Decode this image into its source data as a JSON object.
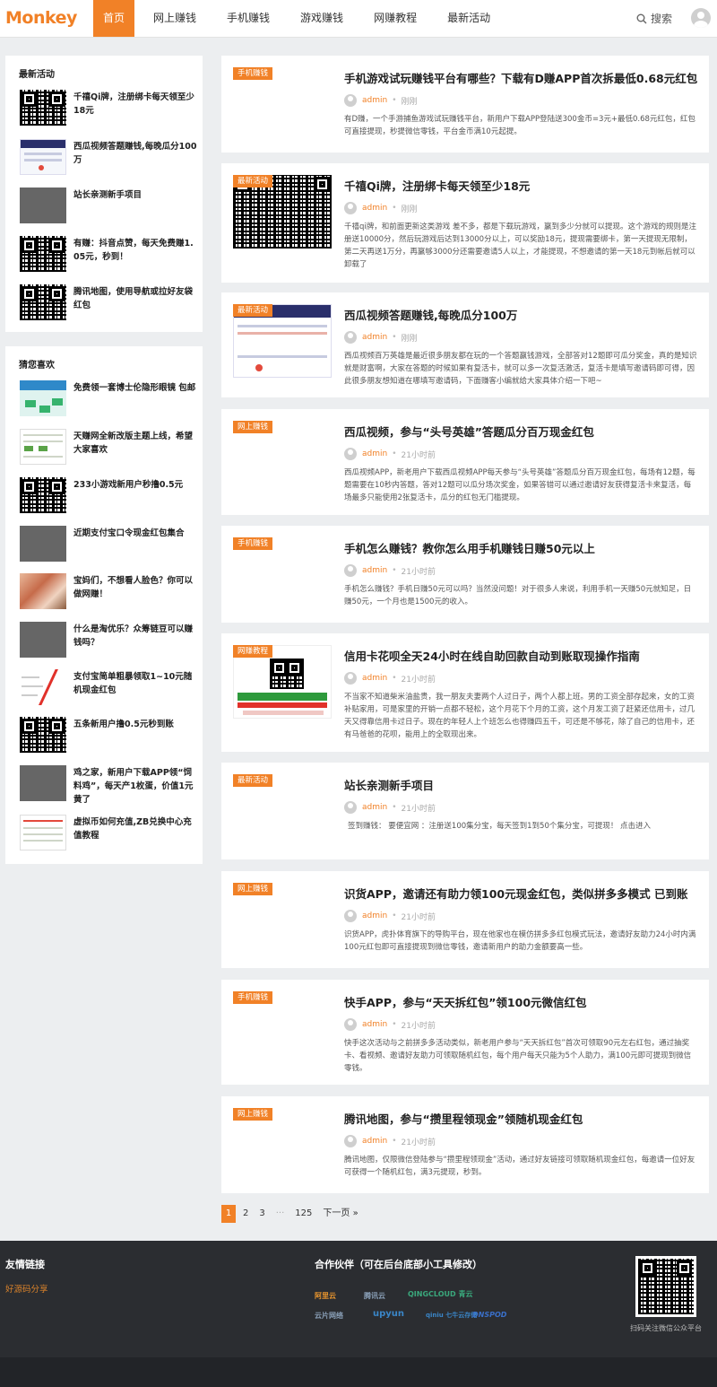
{
  "header": {
    "logo": "Monkey",
    "nav": [
      "首页",
      "网上赚钱",
      "手机赚钱",
      "游戏赚钱",
      "网赚教程",
      "最新活动"
    ],
    "search_label": "搜索"
  },
  "sidebar": {
    "latest_title": "最新活动",
    "latest": [
      "千禧Qi牌，注册绑卡每天领至少18元",
      "西瓜视频答题赚钱,每晚瓜分100万",
      "站长亲测新手项目",
      "有赚：抖音点赞，每天免费赚1.05元，秒到！",
      "腾讯地图，使用导航或拉好友袋红包"
    ],
    "guess_title": "猜您喜欢",
    "guess": [
      "免费领一套博士伦隐形眼镜 包邮",
      "天赚网全新改版主题上线，希望大家喜欢",
      "233小游戏新用户秒撸0.5元",
      "近期支付宝口令现金红包集合",
      "宝妈们，不想看人脸色？你可以做网赚！",
      "什么是淘优乐？众筹链豆可以赚钱吗？",
      "支付宝简单粗暴领取1~10元随机现金红包",
      "五条新用户撸0.5元秒到账",
      "鸡之家，新用户下载APP领“饲料鸡”，每天产1枚蛋，价值1元 黄了",
      "虚拟币如何充值,ZB兑换中心充值教程"
    ]
  },
  "posts": [
    {
      "tag": "手机赚钱",
      "title": "手机游戏试玩赚钱平台有哪些？下载有D赚APP首次拆最低0.68元红包",
      "author": "admin",
      "time": "刚刚",
      "excerpt": "有D赚，一个手游捕鱼游戏试玩赚钱平台，新用户下载APP登陆送300金币=3元+最低0.68元红包，红包可直接提现，秒提微信零钱，平台金币满10元起提。"
    },
    {
      "tag": "最新活动",
      "title": "千禧Qi牌，注册绑卡每天领至少18元",
      "author": "admin",
      "time": "刚刚",
      "excerpt": "千禧qi牌，和前面更新这类游戏 差不多，都是下载玩游戏，赢到多少分就可以提现。这个游戏的规则是注册送10000分，然后玩游戏后达到13000分以上，可以奖励18元，提现需要绑卡，第一天提现无限制，第二天再送1万分，再赢够3000分还需要邀请5人以上，才能提现，不想邀请的第一天18元到帐后就可以卸载了"
    },
    {
      "tag": "最新活动",
      "title": "西瓜视频答题赚钱,每晚瓜分100万",
      "author": "admin",
      "time": "刚刚",
      "excerpt": "西瓜视频百万英雄是最近很多朋友都在玩的一个答题赢钱游戏，全部答对12题即可瓜分奖金，真的是知识就是财富啊，大家在答题的时候如果有复活卡，就可以多一次复活激活，复活卡是填写邀请码即可得，因此很多朋友想知道在哪填写邀请码，下面赚客小编就给大家具体介绍一下吧~"
    },
    {
      "tag": "网上赚钱",
      "title": "西瓜视频，参与“头号英雄”答题瓜分百万现金红包",
      "author": "admin",
      "time": "21小时前",
      "excerpt": "西瓜视频APP，新老用户下载西瓜视频APP每天参与“头号英雄”答题瓜分百万现金红包，每场有12题，每题需要在10秒内答题，答对12题可以瓜分场次奖金，如果答错可以通过邀请好友获得复活卡来复活，每场最多只能使用2张复活卡，瓜分的红包无门槛提现。"
    },
    {
      "tag": "手机赚钱",
      "title": "手机怎么赚钱？教你怎么用手机赚钱日赚50元以上",
      "author": "admin",
      "time": "21小时前",
      "excerpt": "手机怎么赚钱？手机日赚50元可以吗？当然没问题！对于很多人来说，利用手机一天赚50元就知足，日赚50元，一个月也是1500元的收入。"
    },
    {
      "tag": "网赚教程",
      "title": "信用卡花呗全天24小时在线自助回款自动到账取现操作指南",
      "author": "admin",
      "time": "21小时前",
      "excerpt": "不当家不知道柴米油盐贵，我一朋友夫妻两个人过日子，两个人都上班。男的工资全部存起来，女的工资补贴家用，可是家里的开销一点都不轻松，这个月花下个月的工资，这个月发工资了赶紧还信用卡，过几天又得靠信用卡过日子。现在的年轻人上个班怎么也得赚四五千，可还是不够花，除了自己的信用卡，还有马爸爸的花呗，能用上的全取现出来。"
    },
    {
      "tag": "最新活动",
      "title": "站长亲测新手项目",
      "author": "admin",
      "time": "21小时前",
      "excerpt": "签到赚钱： 要便宜网 ：注册送100集分宝，每天签到1到50个集分宝，可提现！ 点击进入"
    },
    {
      "tag": "网上赚钱",
      "title": "识货APP，邀请还有助力领100元现金红包，类似拼多多模式 已到账",
      "author": "admin",
      "time": "21小时前",
      "excerpt": "识货APP，虎扑体育旗下的导购平台，现在他家也在模仿拼多多红包模式玩法，邀请好友助力24小时内满100元红包即可直接提现到微信零钱，邀请新用户的助力金额要高一些。"
    },
    {
      "tag": "手机赚钱",
      "title": "快手APP，参与“天天拆红包”领100元微信红包",
      "author": "admin",
      "time": "21小时前",
      "excerpt": "快手这次活动与之前拼多多活动类似，新老用户参与“天天拆红包”首次可领取90元左右红包，通过抽奖卡、看视频、邀请好友助力可领取随机红包，每个用户每天只能为5个人助力，满100元即可提现到微信零钱。"
    },
    {
      "tag": "网上赚钱",
      "title": "腾讯地图，参与“攒里程领现金”领随机现金红包",
      "author": "admin",
      "time": "21小时前",
      "excerpt": "腾讯地图，仅限微信登陆参与“攒里程领现金”活动，通过好友链接可领取随机现金红包，每邀请一位好友可获得一个随机红包，满3元提现，秒到。"
    }
  ],
  "pager": {
    "pages": [
      "1",
      "2",
      "3",
      "···",
      "125"
    ],
    "next": "下一页 »"
  },
  "footer": {
    "links_title": "友情链接",
    "links": [
      "好源码分享"
    ],
    "partners_title": "合作伙伴（可在后台底部小工具修改）",
    "partners": [
      "阿里云",
      "腾讯云",
      "QINGCLOUD 青云",
      "云片网络",
      "upyun",
      "qiniu 七牛云存储",
      "DNSPOD"
    ],
    "qr_caption": "扫码关注微信公众平台"
  },
  "colors": {
    "accent": "#f18127",
    "footer_bg": "#2b2d31"
  }
}
